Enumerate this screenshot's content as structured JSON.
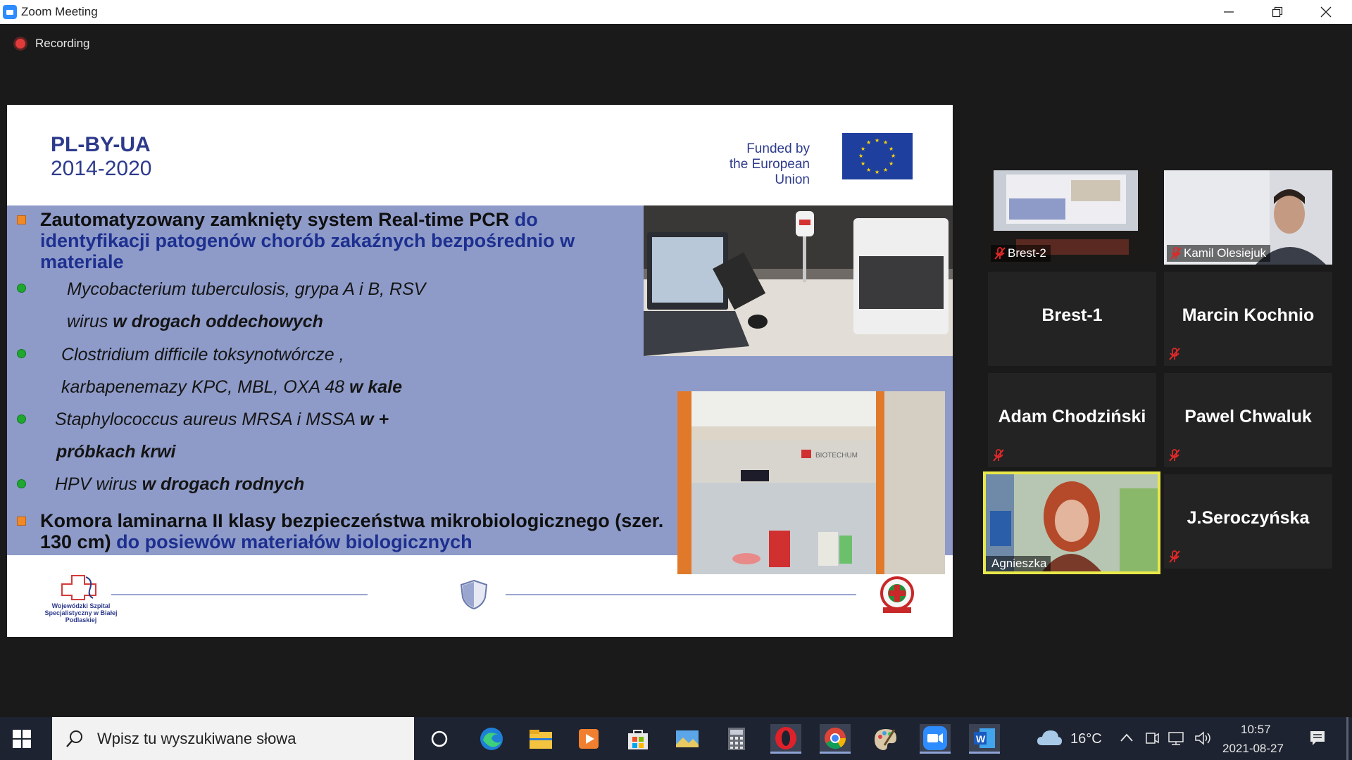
{
  "window": {
    "title": "Zoom Meeting"
  },
  "meeting": {
    "recording_label": "Recording"
  },
  "slide": {
    "program_name": "PL-BY-UA",
    "program_years": "2014-2020",
    "funded_line1": "Funded by",
    "funded_line2": "the European Union",
    "heading1_black": "Zautomatyzowany zamknięty system Real-time PCR",
    "heading1_blue": "do identyfikacji patogenów chorób zakaźnych  bezpośrednio w materiale",
    "bullets": [
      {
        "pre": "Mycobacterium tuberculosis, grypa A  i  B, RSV"
      },
      {
        "pre": "wirus",
        "bold": "w drogach oddechowych"
      },
      {
        "pre": "Clostridium difficile toksynotwórcze ,"
      },
      {
        "pre": "karbapenemazy KPC,  MBL, OXA 48 ",
        "bold": "w kale"
      },
      {
        "pre": "Staphylococcus aureus MRSA i MSSA",
        "bold": "w",
        "post": " +"
      },
      {
        "bold": "próbkach krwi"
      },
      {
        "pre": "HPV wirus",
        "bold": "w drogach rodnych"
      }
    ],
    "heading2_black": "Komora laminarna II klasy bezpieczeństwa mikrobiologicznego (szer. 130 cm)",
    "heading2_blue": "do posiewów materiałów biologicznych",
    "logo_left_text": "Wojewódzki Szpital Specjalistyczny w Białej Podlaskiej",
    "cabinet_brand": "BIOTECHUM"
  },
  "participants": [
    {
      "name": "Brest-2",
      "video": true,
      "muted": true
    },
    {
      "name": "Kamil Olesiejuk",
      "video": true,
      "muted": true
    },
    {
      "name": "Brest-1",
      "video": false,
      "muted": false
    },
    {
      "name": "Marcin Kochnio",
      "video": false,
      "muted": true
    },
    {
      "name": "Adam Chodziński",
      "video": false,
      "muted": true
    },
    {
      "name": "Pawel Chwaluk",
      "video": false,
      "muted": true
    },
    {
      "name": "Agnieszka",
      "video": true,
      "muted": false,
      "active_speaker": true
    },
    {
      "name": "J.Seroczyńska",
      "video": false,
      "muted": true
    }
  ],
  "taskbar": {
    "search_placeholder": "Wpisz tu wyszukiwane słowa",
    "weather_temp": "16°C",
    "time": "10:57",
    "date": "2021-08-27"
  },
  "colors": {
    "zoom_blue": "#2d8cff",
    "active_speaker_border": "#e8e84a",
    "mute_red": "#e02828",
    "slide_band": "#8e9bc9",
    "slide_blue_text": "#1d2f8f"
  }
}
